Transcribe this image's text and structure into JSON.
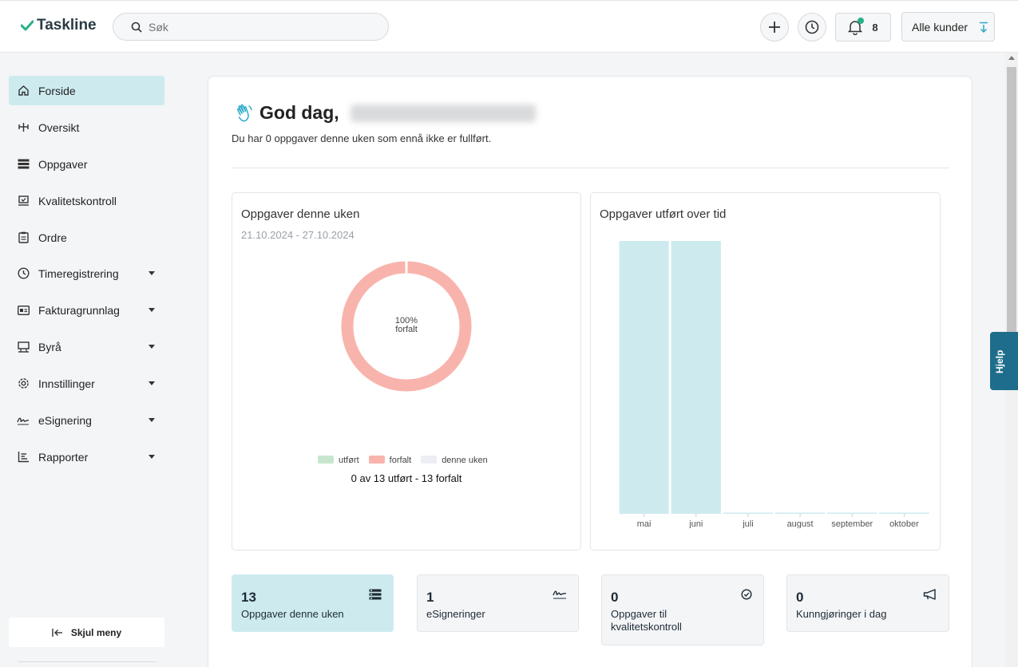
{
  "brand": {
    "name": "Taskline",
    "accent": "#27b18b"
  },
  "search": {
    "placeholder": "Søk"
  },
  "header": {
    "notification_count": "8",
    "customer_select": "Alle kunder"
  },
  "sidebar": {
    "items": [
      {
        "label": "Forside",
        "icon": "home-icon",
        "active": true
      },
      {
        "label": "Oversikt",
        "icon": "sitemap-icon"
      },
      {
        "label": "Oppgaver",
        "icon": "tasks-icon"
      },
      {
        "label": "Kvalitetskontroll",
        "icon": "quality-check-icon"
      },
      {
        "label": "Ordre",
        "icon": "clipboard-icon"
      },
      {
        "label": "Timeregistrering",
        "icon": "clock-icon",
        "expandable": true
      },
      {
        "label": "Fakturagrunnlag",
        "icon": "invoice-icon",
        "expandable": true
      },
      {
        "label": "Byrå",
        "icon": "office-icon",
        "expandable": true
      },
      {
        "label": "Innstillinger",
        "icon": "gear-icon",
        "expandable": true
      },
      {
        "label": "eSignering",
        "icon": "signature-icon",
        "expandable": true
      },
      {
        "label": "Rapporter",
        "icon": "report-icon",
        "expandable": true
      }
    ],
    "hide_label": "Skjul meny"
  },
  "main": {
    "greeting": "God dag,",
    "subtitle": "Du har 0 oppgaver denne uken som ennå ikke er fullført.",
    "weekly_panel": {
      "title": "Oppgaver denne uken",
      "date_range": "21.10.2024 - 27.10.2024",
      "center_percent": "100%",
      "center_label": "forfalt",
      "summary": "0 av 13 utført - 13 forfalt"
    },
    "history_panel": {
      "title": "Oppgaver utført over tid"
    },
    "stats": [
      {
        "value": "13",
        "label": "Oppgaver denne uken",
        "icon": "tasks-icon",
        "active": true
      },
      {
        "value": "1",
        "label": "eSigneringer",
        "icon": "signature-icon"
      },
      {
        "value": "0",
        "label": "Oppgaver til kvalitetskontroll",
        "icon": "check-circle-icon"
      },
      {
        "value": "0",
        "label": "Kunngjøringer i dag",
        "icon": "megaphone-icon"
      }
    ]
  },
  "help_tab": "Hjelp",
  "chart_data": [
    {
      "type": "pie",
      "categories": [
        "utført",
        "forfalt",
        "denne uken"
      ],
      "values": [
        0,
        13,
        0
      ],
      "colors": [
        "#c8e6cf",
        "#f8b4ac",
        "#eceef3"
      ],
      "legend": "bottom"
    },
    {
      "type": "bar",
      "categories": [
        "mai",
        "juni",
        "juli",
        "august",
        "september",
        "oktober"
      ],
      "values": [
        1,
        1,
        0,
        0,
        0,
        0
      ],
      "color": "#cdebef",
      "ylim": [
        0,
        1
      ],
      "grid": false
    }
  ]
}
